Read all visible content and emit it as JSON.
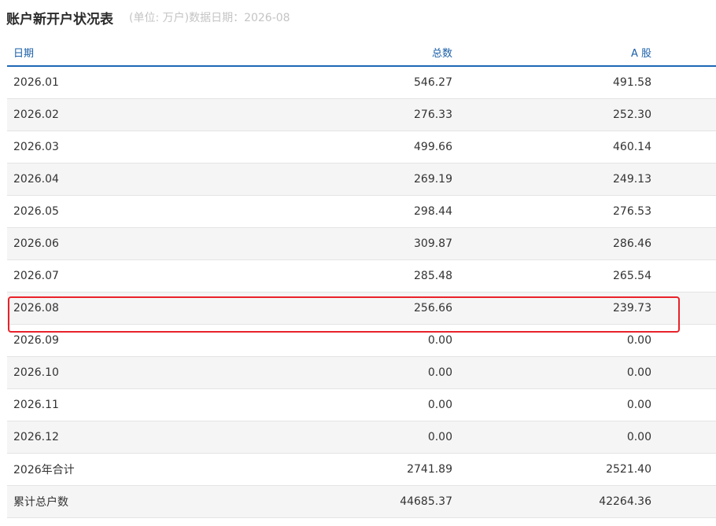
{
  "header": {
    "title": "账户新开户状况表",
    "subtitle": "(单位: 万户)数据日期：2026-08"
  },
  "table": {
    "columns": [
      "日期",
      "总数",
      "A 股"
    ],
    "rows": [
      [
        "2026.01",
        "546.27",
        "491.58"
      ],
      [
        "2026.02",
        "276.33",
        "252.30"
      ],
      [
        "2026.03",
        "499.66",
        "460.14"
      ],
      [
        "2026.04",
        "269.19",
        "249.13"
      ],
      [
        "2026.05",
        "298.44",
        "276.53"
      ],
      [
        "2026.06",
        "309.87",
        "286.46"
      ],
      [
        "2026.07",
        "285.48",
        "265.54"
      ],
      [
        "2026.08",
        "256.66",
        "239.73"
      ],
      [
        "2026.09",
        "0.00",
        "0.00"
      ],
      [
        "2026.10",
        "0.00",
        "0.00"
      ],
      [
        "2026.11",
        "0.00",
        "0.00"
      ],
      [
        "2026.12",
        "0.00",
        "0.00"
      ],
      [
        "2026年合计",
        "2741.89",
        "2521.40"
      ],
      [
        "累计总户数",
        "44685.37",
        "42264.36"
      ]
    ]
  },
  "colors": {
    "header_text": "#1a5fa8",
    "header_rule": "#1d68b5",
    "highlight": "#e8222a",
    "stripe": "#f5f5f5"
  }
}
